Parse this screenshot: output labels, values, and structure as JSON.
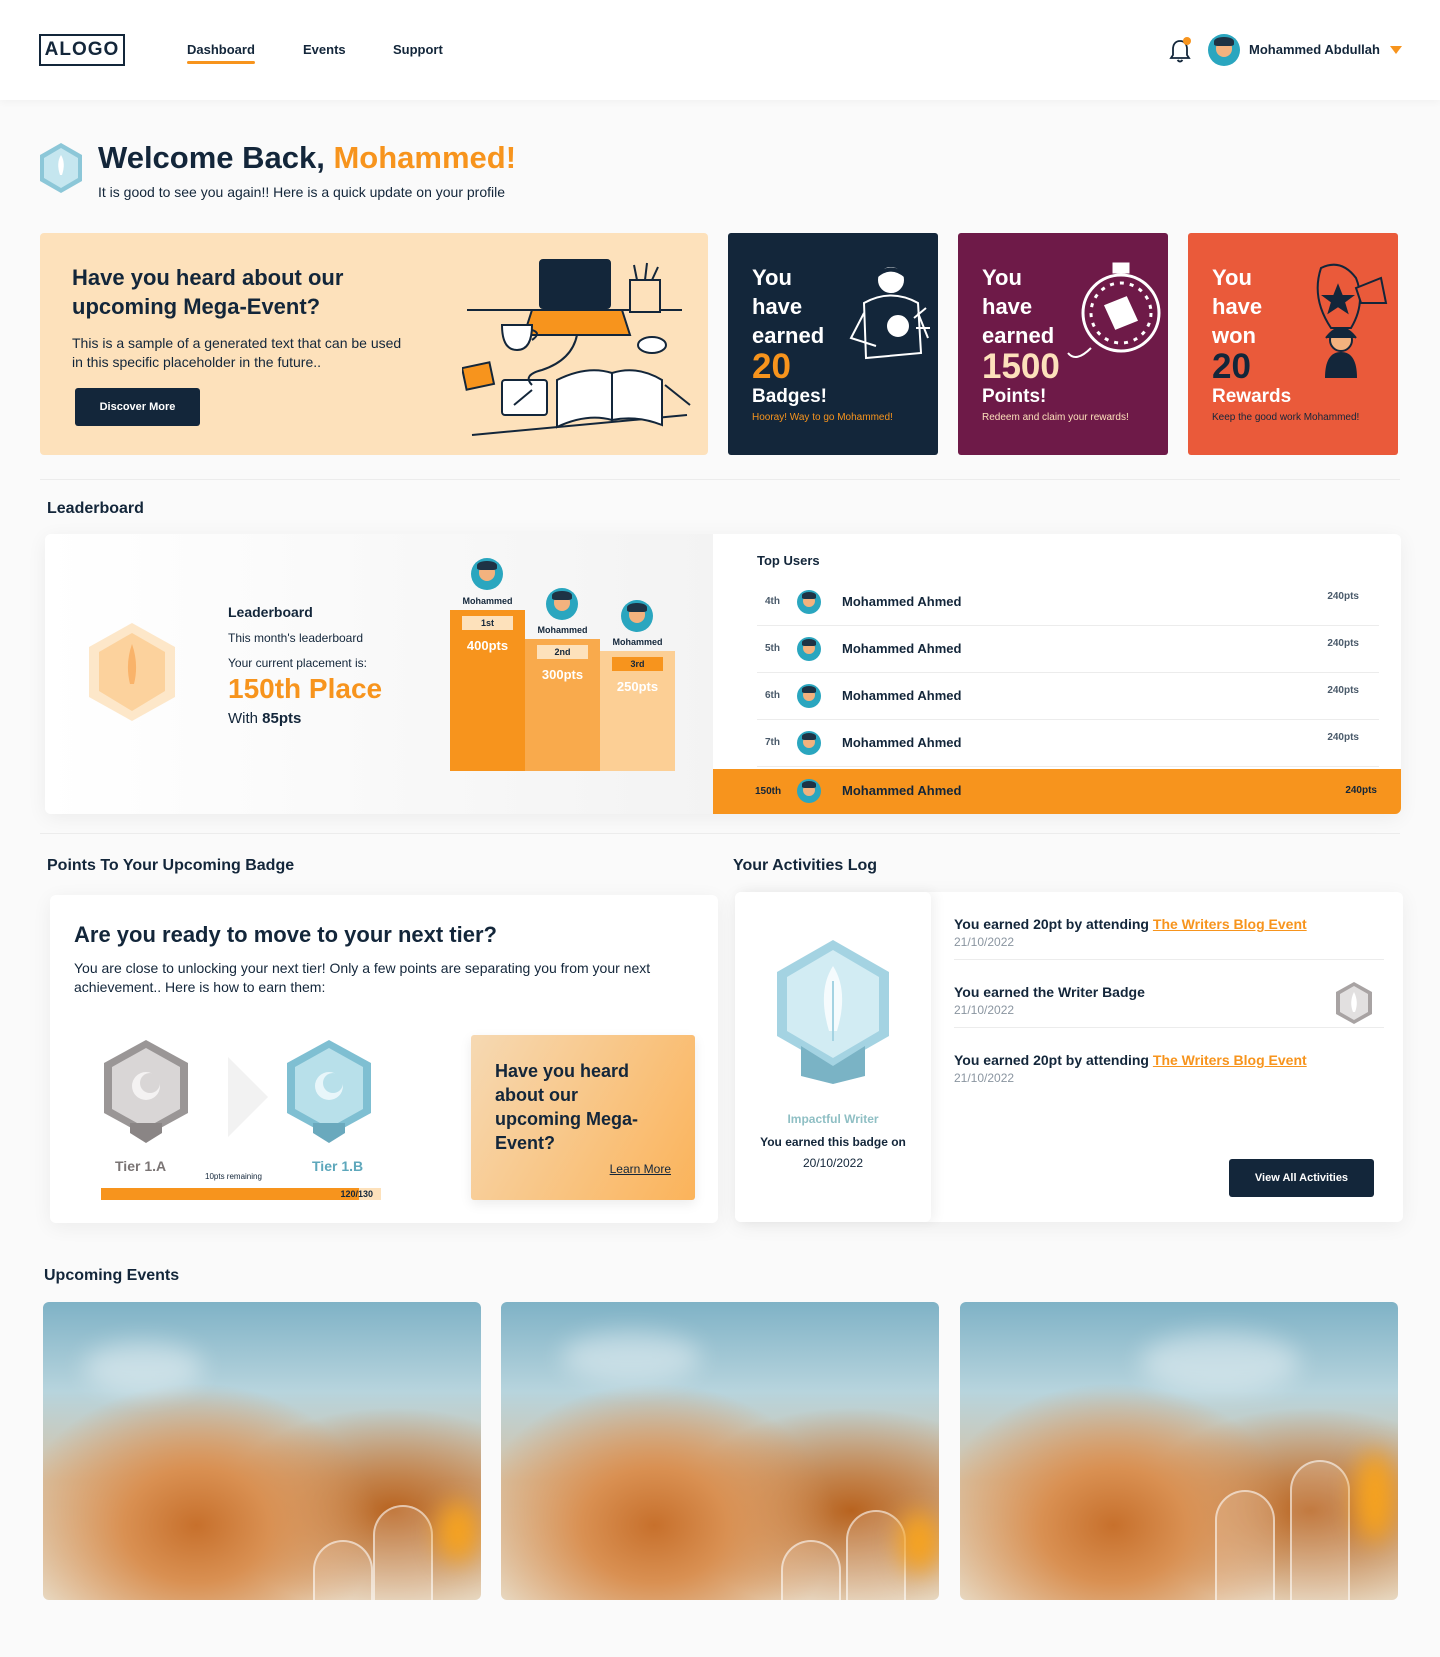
{
  "header": {
    "logo": "ALOGO",
    "nav": [
      {
        "label": "Dashboard",
        "active": true
      },
      {
        "label": "Events",
        "active": false
      },
      {
        "label": "Support",
        "active": false
      }
    ],
    "user_name": "Mohammed Abdullah",
    "notification_icon": "bell-icon"
  },
  "welcome": {
    "title_prefix": "Welcome Back, ",
    "title_name": "Mohammed!",
    "subtitle": "It is good to see you again!! Here is a quick update on your profile"
  },
  "promo": {
    "title": "Have you heard about our upcoming Mega-Event?",
    "text": "This is a sample of a generated text that can be used in this specific placeholder in the future..",
    "button": "Discover More"
  },
  "stats": [
    {
      "line1": "You",
      "line2": "have",
      "line3": "earned",
      "number": "20",
      "unit": "Badges!",
      "footer": "Hooray! Way to go Mohammed!",
      "bg": "#13263a",
      "accent": "#f7941d"
    },
    {
      "line1": "You",
      "line2": "have",
      "line3": "earned",
      "number": "1500",
      "unit": "Points!",
      "footer": "Redeem and claim your rewards!",
      "bg": "#6e1a48",
      "accent": "#fde1bb"
    },
    {
      "line1": "You",
      "line2": "have",
      "line3": "won",
      "number": "20",
      "unit": "Rewards",
      "footer": "Keep the good work Mohammed!",
      "bg": "#ea5a3a",
      "accent": "#13263a"
    }
  ],
  "leaderboard": {
    "section_title": "Leaderboard",
    "heading": "Leaderboard",
    "subtitle": "This month's leaderboard",
    "placement_label": "Your current placement is:",
    "placement": "150th Place",
    "with_prefix": "With ",
    "with_pts": "85pts",
    "podium": [
      {
        "name": "Mohammed",
        "rank": "1st",
        "pts": "400pts"
      },
      {
        "name": "Mohammed",
        "rank": "2nd",
        "pts": "300pts"
      },
      {
        "name": "Mohammed",
        "rank": "3rd",
        "pts": "250pts"
      }
    ],
    "top_users_title": "Top Users",
    "rows": [
      {
        "rank": "4th",
        "name": "Mohammed Ahmed",
        "pts": "240pts"
      },
      {
        "rank": "5th",
        "name": "Mohammed Ahmed",
        "pts": "240pts"
      },
      {
        "rank": "6th",
        "name": "Mohammed Ahmed",
        "pts": "240pts"
      },
      {
        "rank": "7th",
        "name": "Mohammed Ahmed",
        "pts": "240pts"
      }
    ],
    "me": {
      "rank": "150th",
      "name": "Mohammed Ahmed",
      "pts": "240pts"
    }
  },
  "tier": {
    "section_title": "Points To Your Upcoming Badge",
    "title": "Are you ready to move to your next tier?",
    "text": "You are close to unlocking your next tier! Only a few points are separating you from your next achievement.. Here is how to earn them:",
    "current_tier": "Tier 1.A",
    "next_tier": "Tier 1.B",
    "remaining": "10pts remaining",
    "progress_text": "120/130",
    "progress_fraction": 0.923,
    "promo_title": "Have you heard about our upcoming Mega-Event?",
    "promo_link": "Learn More"
  },
  "activities": {
    "section_title": "Your Activities Log",
    "badge_name": "Impactful Writer",
    "badge_earned": "You earned this badge on",
    "badge_date": "20/10/2022",
    "items": [
      {
        "text": "You earned 20pt by attending ",
        "link": "The Writers Blog Event",
        "date": "21/10/2022"
      },
      {
        "text": "You earned the Writer Badge",
        "link": "",
        "date": "21/10/2022"
      },
      {
        "text": "You earned 20pt by attending ",
        "link": "The Writers Blog Event",
        "date": "21/10/2022"
      }
    ],
    "button": "View All Activities"
  },
  "events": {
    "section_title": "Upcoming Events"
  },
  "colors": {
    "accent": "#f7941d",
    "navy": "#13263a",
    "peach": "#fde1bb",
    "plum": "#6e1a48",
    "coral": "#ea5a3a"
  }
}
